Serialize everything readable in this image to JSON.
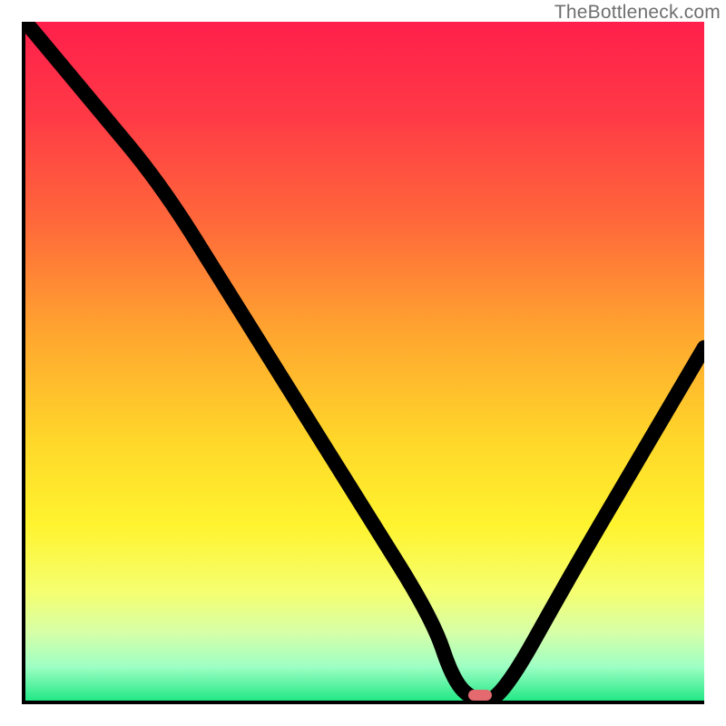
{
  "watermark": "TheBottleneck.com",
  "chart_data": {
    "type": "line",
    "title": "",
    "xlabel": "",
    "ylabel": "",
    "ylim": [
      0,
      100
    ],
    "xlim": [
      0,
      100
    ],
    "x": [
      0,
      10,
      20,
      30,
      40,
      50,
      60,
      63,
      66,
      70,
      80,
      90,
      100
    ],
    "bottleneck_pct": [
      100,
      88,
      76,
      60,
      44,
      28,
      12,
      3,
      0,
      0,
      18,
      35,
      52
    ],
    "optimal_marker": {
      "x": 67,
      "y": 0,
      "w": 3.4,
      "h": 1.6
    },
    "gradient_stops": [
      {
        "offset": 0.0,
        "color": "#ff1f4b"
      },
      {
        "offset": 0.14,
        "color": "#ff3a46"
      },
      {
        "offset": 0.3,
        "color": "#ff6a3a"
      },
      {
        "offset": 0.46,
        "color": "#ffa62f"
      },
      {
        "offset": 0.62,
        "color": "#ffd82a"
      },
      {
        "offset": 0.74,
        "color": "#fff32e"
      },
      {
        "offset": 0.84,
        "color": "#f5ff70"
      },
      {
        "offset": 0.9,
        "color": "#d6ffa8"
      },
      {
        "offset": 0.95,
        "color": "#9effc4"
      },
      {
        "offset": 1.0,
        "color": "#22e886"
      }
    ]
  }
}
